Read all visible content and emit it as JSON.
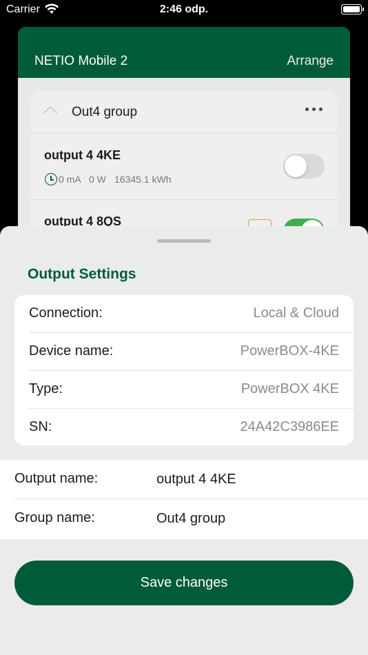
{
  "status_bar": {
    "carrier": "Carrier",
    "time": "2:46 odp.",
    "wifi_icon": "wifi-icon",
    "battery_icon": "battery-icon"
  },
  "background_app": {
    "title": "NETIO Mobile 2",
    "arrange_label": "Arrange",
    "header_color": "#005b39",
    "group": {
      "title": "Out4 group",
      "collapse_icon": "chevron-up-icon",
      "more_icon": "more-dots-icon",
      "outputs": [
        {
          "name": "output 4 4KE",
          "current": "0 mA",
          "power": "0 W",
          "energy": "16345.1 kWh",
          "toggle_on": false
        },
        {
          "name": "output 4 8QS",
          "toggle_on": true
        }
      ]
    }
  },
  "sheet": {
    "title": "Output Settings",
    "info_rows": [
      {
        "label": "Connection:",
        "value": "Local & Cloud"
      },
      {
        "label": "Device name:",
        "value": "PowerBOX-4KE"
      },
      {
        "label": "Type:",
        "value": "PowerBOX 4KE"
      },
      {
        "label": "SN:",
        "value": "24A42C3986EE"
      }
    ],
    "edit_rows": [
      {
        "label": "Output name:",
        "value": "output 4 4KE"
      },
      {
        "label": "Group name:",
        "value": "Out4 group"
      }
    ],
    "save_label": "Save changes",
    "accent_color": "#005b39"
  }
}
